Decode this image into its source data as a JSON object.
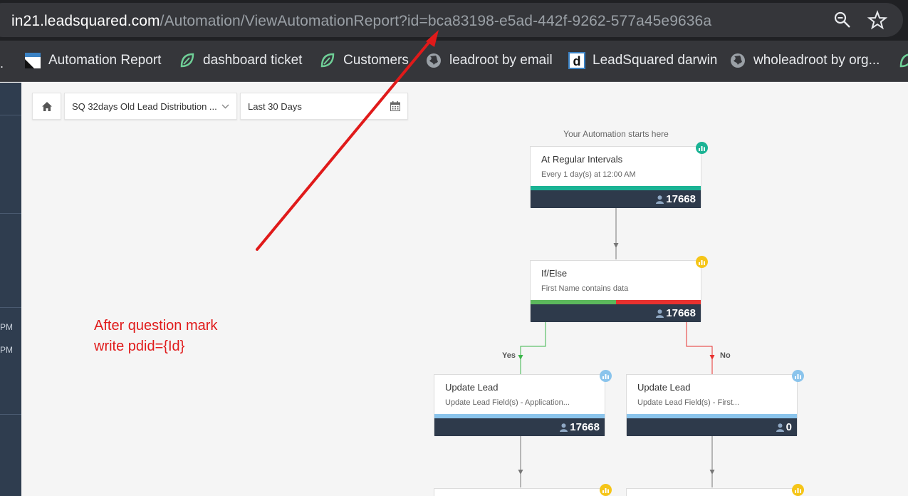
{
  "browser": {
    "url_domain": "in21.leadsquared.com",
    "url_path": "/Automation/ViewAutomationReport?id=bca83198-e5ad-442f-9262-577a45e9636a",
    "bookmarks": [
      {
        "label": "Automation Report",
        "icon": "automation-report-icon"
      },
      {
        "label": "dashboard ticket",
        "icon": "leaf-icon"
      },
      {
        "label": "Customers",
        "icon": "leaf-icon"
      },
      {
        "label": "leadroot by email",
        "icon": "globe-icon"
      },
      {
        "label": "LeadSquared darwin",
        "icon": "d-logo-icon"
      },
      {
        "label": "wholeadroot by org...",
        "icon": "globe-icon"
      }
    ]
  },
  "sidebar": {
    "times": [
      "PM",
      "PM"
    ]
  },
  "filters": {
    "automation": "SQ 32days Old Lead Distribution ...",
    "date_range": "Last 30 Days"
  },
  "flow": {
    "start_label": "Your Automation starts here",
    "nodes": [
      {
        "title": "At Regular Intervals",
        "subtitle": "Every 1 day(s) at 12:00 AM",
        "count": "17668",
        "bar_color": "#1ab394",
        "badge_color": "#1ab394"
      },
      {
        "title": "If/Else",
        "subtitle": "First Name contains data",
        "count": "17668",
        "bar_colors": [
          "#5cb85c",
          "#e8312f"
        ],
        "badge_color": "#f5c518"
      },
      {
        "title": "Update Lead",
        "subtitle": "Update Lead Field(s) - Application...",
        "count": "17668",
        "bar_color": "#8ac4ec",
        "badge_color": "#8ac4ec"
      },
      {
        "title": "Update Lead",
        "subtitle": "Update Lead Field(s) - First...",
        "count": "0",
        "bar_color": "#8ac4ec",
        "badge_color": "#8ac4ec"
      }
    ],
    "branches": {
      "yes": "Yes",
      "no": "No"
    }
  },
  "annotation": {
    "line1": "After question mark",
    "line2": "write pdid={Id}",
    "color": "#e01a1a"
  }
}
